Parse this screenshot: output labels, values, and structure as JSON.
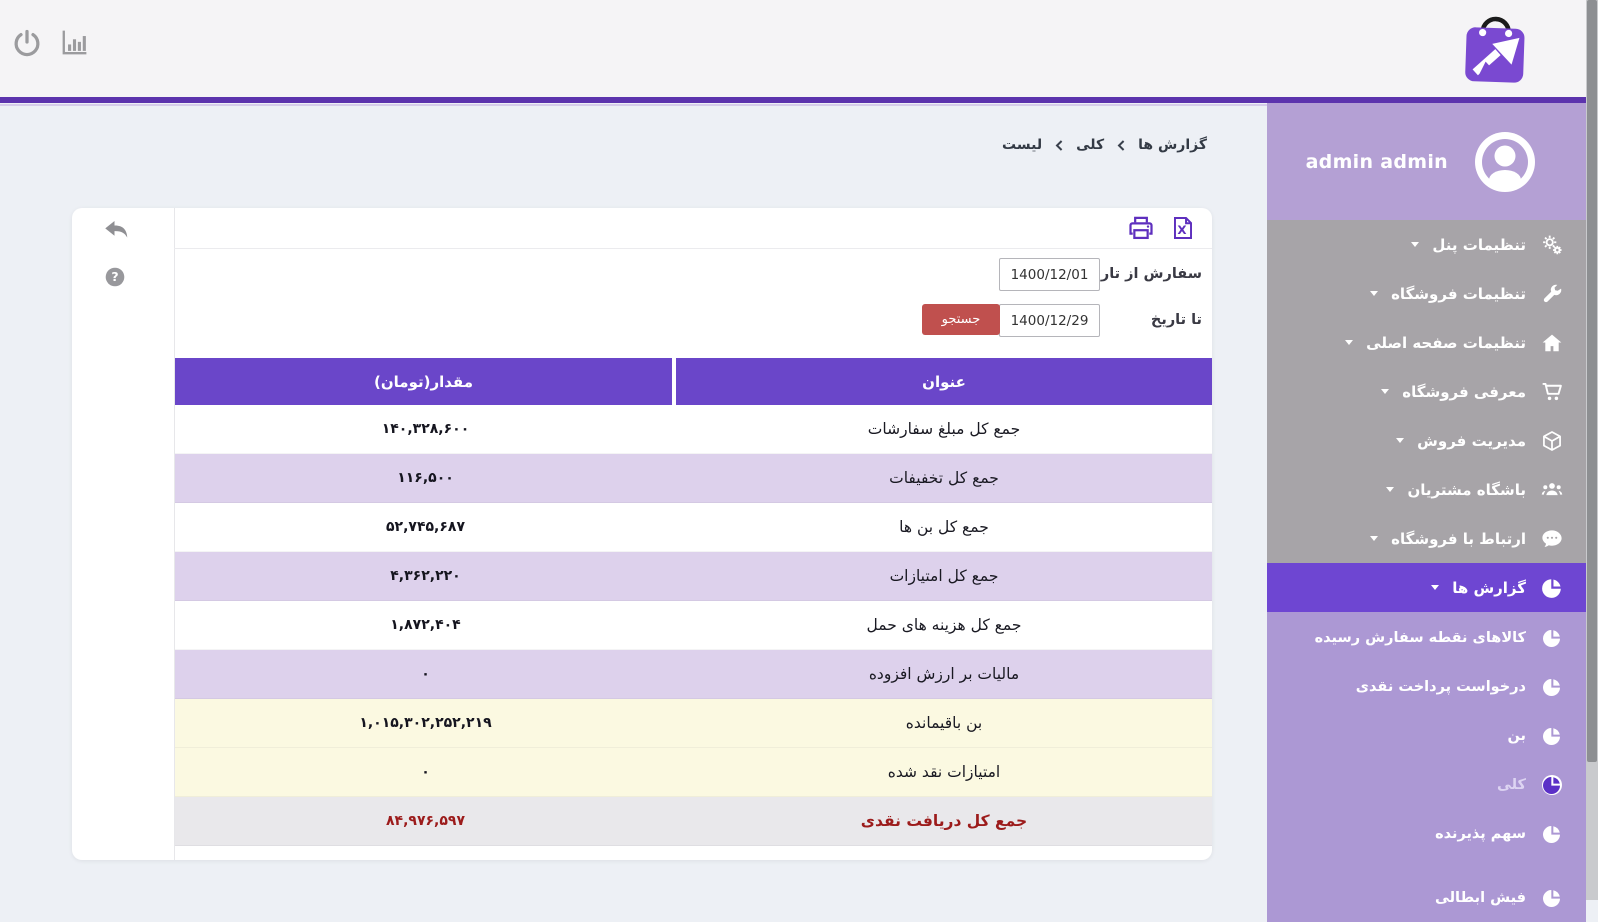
{
  "colors": {
    "accent_purple": "#5c33ad",
    "table_header_purple": "#6a46c9",
    "active_menu_purple": "#6e46d2",
    "sidebar_gray": "#a7a4a8",
    "sidebar_user_purple": "#b4a0d4",
    "submenu_purple": "#ac98d4",
    "row_alt_purple": "#ddd1ec",
    "row_yellow": "#fbf9e1",
    "row_total_gray": "#e9e8eb",
    "total_text_red": "#9c1b1b",
    "search_button_red": "#c0504e",
    "logo_purple": "#7a49d1"
  },
  "topbar": {
    "icons": [
      "power-icon",
      "bar-chart-icon"
    ],
    "logo": "shopping-bag-logo"
  },
  "breadcrumb": {
    "items": [
      "گزارش ها",
      "کلی",
      "لیست"
    ]
  },
  "sidebar": {
    "user": "admin admin",
    "menu": [
      {
        "label": "تنظیمات پنل",
        "icon": "gears-icon"
      },
      {
        "label": "تنظیمات فروشگاه",
        "icon": "wrench-icon"
      },
      {
        "label": "تنظیمات صفحه اصلی",
        "icon": "home-icon"
      },
      {
        "label": "معرفی فروشگاه",
        "icon": "cart-icon"
      },
      {
        "label": "مدیریت فروش",
        "icon": "cube-icon"
      },
      {
        "label": "باشگاه مشتریان",
        "icon": "users-icon"
      },
      {
        "label": "ارتباط با فروشگاه",
        "icon": "comment-icon"
      },
      {
        "label": "گزارش ها",
        "icon": "pie-icon",
        "active": true
      }
    ],
    "submenu": [
      {
        "label": "کالاهای نقطه سفارش رسیده"
      },
      {
        "label": "درخواست پرداخت نقدی"
      },
      {
        "label": "بن"
      },
      {
        "label": "کلی",
        "active": true
      },
      {
        "label": "سهم پذیرنده"
      },
      {
        "label": "فیش ابطالی"
      }
    ]
  },
  "card": {
    "side_icons": [
      "back-icon",
      "help-icon"
    ],
    "tool_icons": [
      "print-icon",
      "excel-icon"
    ]
  },
  "filters": {
    "from_label": "سفارش از تاریخ",
    "from_value": "1400/12/01",
    "to_label": "تا تاریخ",
    "to_value": "1400/12/29",
    "search_label": "جستجو"
  },
  "table": {
    "headers": {
      "title": "عنوان",
      "amount": "مقدار(تومان)"
    },
    "rows": [
      {
        "title": "جمع کل مبلغ سفارشات",
        "amount": "۱۴۰,۳۲۸,۶۰۰",
        "style": "white"
      },
      {
        "title": "جمع کل تخفیفات",
        "amount": "۱۱۶,۵۰۰",
        "style": "purple"
      },
      {
        "title": "جمع کل بن ها",
        "amount": "۵۲,۷۴۵,۶۸۷",
        "style": "white"
      },
      {
        "title": "جمع کل امتیازات",
        "amount": "۴,۳۶۲,۲۲۰",
        "style": "purple"
      },
      {
        "title": "جمع کل هزینه های حمل",
        "amount": "۱,۸۷۲,۴۰۴",
        "style": "white"
      },
      {
        "title": "مالیات بر ارزش افزوده",
        "amount": "۰",
        "style": "purple"
      },
      {
        "title": "بن باقیمانده",
        "amount": "۱,۰۱۵,۳۰۲,۲۵۲,۲۱۹",
        "style": "yellow"
      },
      {
        "title": "امتیازات نقد شده",
        "amount": "۰",
        "style": "yellow"
      },
      {
        "title": "جمع کل دریافت نقدی",
        "amount": "۸۴,۹۷۶,۵۹۷",
        "style": "red"
      }
    ]
  }
}
